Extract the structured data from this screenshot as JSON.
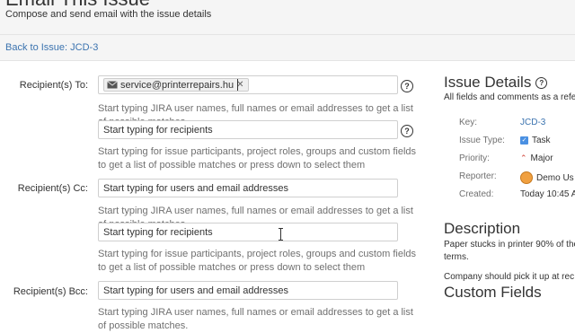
{
  "header": {
    "title": "Email This Issue",
    "subtitle": "Compose and send email with the issue details"
  },
  "back_link": "Back to Issue: JCD-3",
  "form": {
    "to_label": "Recipient(s) To:",
    "to_chip": "service@printerrepairs.hu",
    "to_help": "Start typing JIRA user names, full names or email addresses to get a list of possible matches.",
    "recipients_placeholder_1": "Start typing for recipients",
    "recipients_help_1": "Start typing for issue participants, project roles, groups and custom fields to get a list of possible matches or press down to select them",
    "cc_label": "Recipient(s) Cc:",
    "cc_placeholder": "Start typing for users and email addresses",
    "cc_help": "Start typing JIRA user names, full names or email addresses to get a list of possible matches.",
    "recipients_placeholder_2": "Start typing for recipients",
    "recipients_help_2": "Start typing for issue participants, project roles, groups and custom fields to get a list of possible matches or press down to select them",
    "bcc_label": "Recipient(s) Bcc:",
    "bcc_placeholder": "Start typing for users and email addresses",
    "bcc_help": "Start typing JIRA user names, full names or email addresses to get a list of possible matches.",
    "help_icon": "question-circle-icon"
  },
  "issue_details": {
    "title": "Issue Details",
    "subtitle": "All fields and comments as a refe",
    "key_label": "Key:",
    "key_value": "JCD-3",
    "type_label": "Issue Type:",
    "type_value": "Task",
    "priority_label": "Priority:",
    "priority_value": "Major",
    "reporter_label": "Reporter:",
    "reporter_value": "Demo Us",
    "created_label": "Created:",
    "created_value": "Today 10:45 A"
  },
  "description": {
    "title": "Description",
    "line1": "Paper stucks in printer 90% of the",
    "line2": "terms.",
    "line3": "Company should pick it up at rec"
  },
  "custom_fields": {
    "title": "Custom Fields"
  },
  "colors": {
    "link": "#3b73af",
    "task": "#4a90e2",
    "major": "#d04437"
  }
}
